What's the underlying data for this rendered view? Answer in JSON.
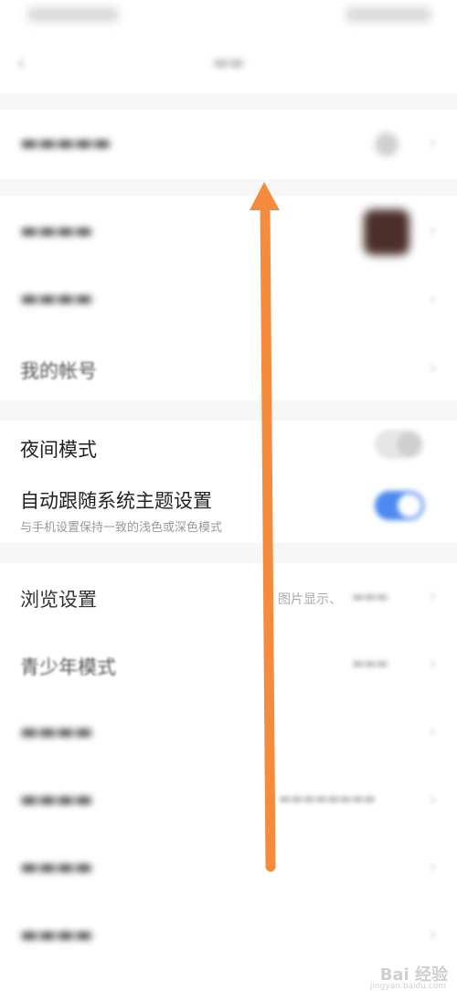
{
  "rows": {
    "account": {
      "label": "我的帐号"
    },
    "night_mode": {
      "label": "夜间模式"
    },
    "auto_theme": {
      "label": "自动跟随系统主题设置",
      "subtitle": "与手机设置保持一致的浅色或深色模式"
    },
    "browse": {
      "label": "浏览设置",
      "value": "图片显示、"
    },
    "teen_mode": {
      "label": "青少年模式"
    }
  },
  "toggles": {
    "night_mode": false,
    "auto_theme": true
  },
  "watermark": {
    "text": "Bai 经验",
    "sub": "jingyan.baidu.com"
  },
  "colors": {
    "arrow": "#f58b3c",
    "toggle_on": "#4b8af0",
    "section_gap": "#f7f7f7"
  }
}
